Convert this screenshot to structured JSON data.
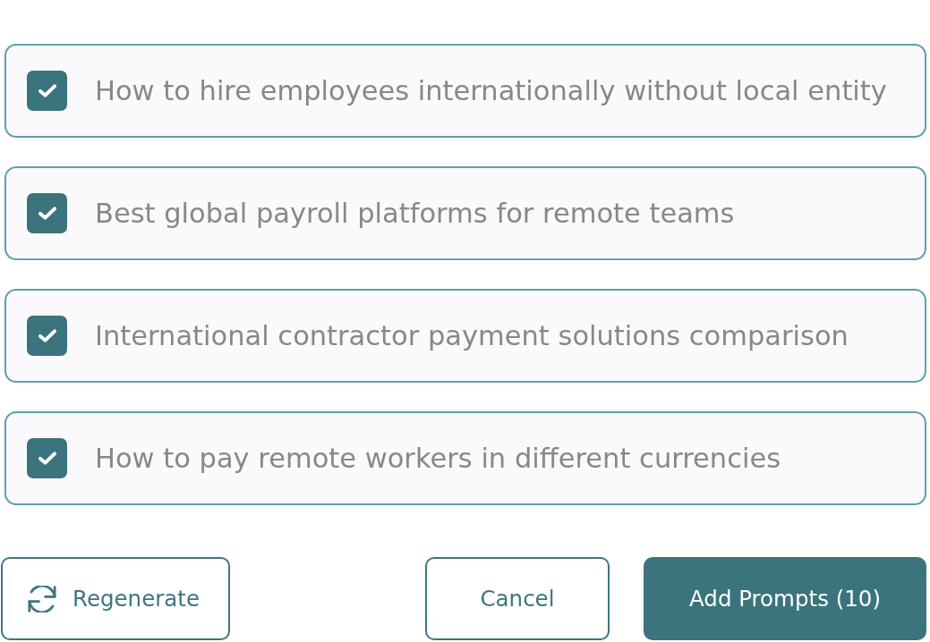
{
  "prompts": [
    {
      "text": "How to hire employees internationally without local entity",
      "checked": true
    },
    {
      "text": "Best global payroll platforms for remote teams",
      "checked": true
    },
    {
      "text": "International contractor payment solutions comparison",
      "checked": true
    },
    {
      "text": "How to pay remote workers in different currencies",
      "checked": true
    }
  ],
  "buttons": [
    {
      "label": "Regenerate",
      "kind": "refresh"
    },
    {
      "label": "Cancel",
      "kind": "outline"
    },
    {
      "label": "Add Prompts (10)",
      "kind": "primary"
    }
  ]
}
